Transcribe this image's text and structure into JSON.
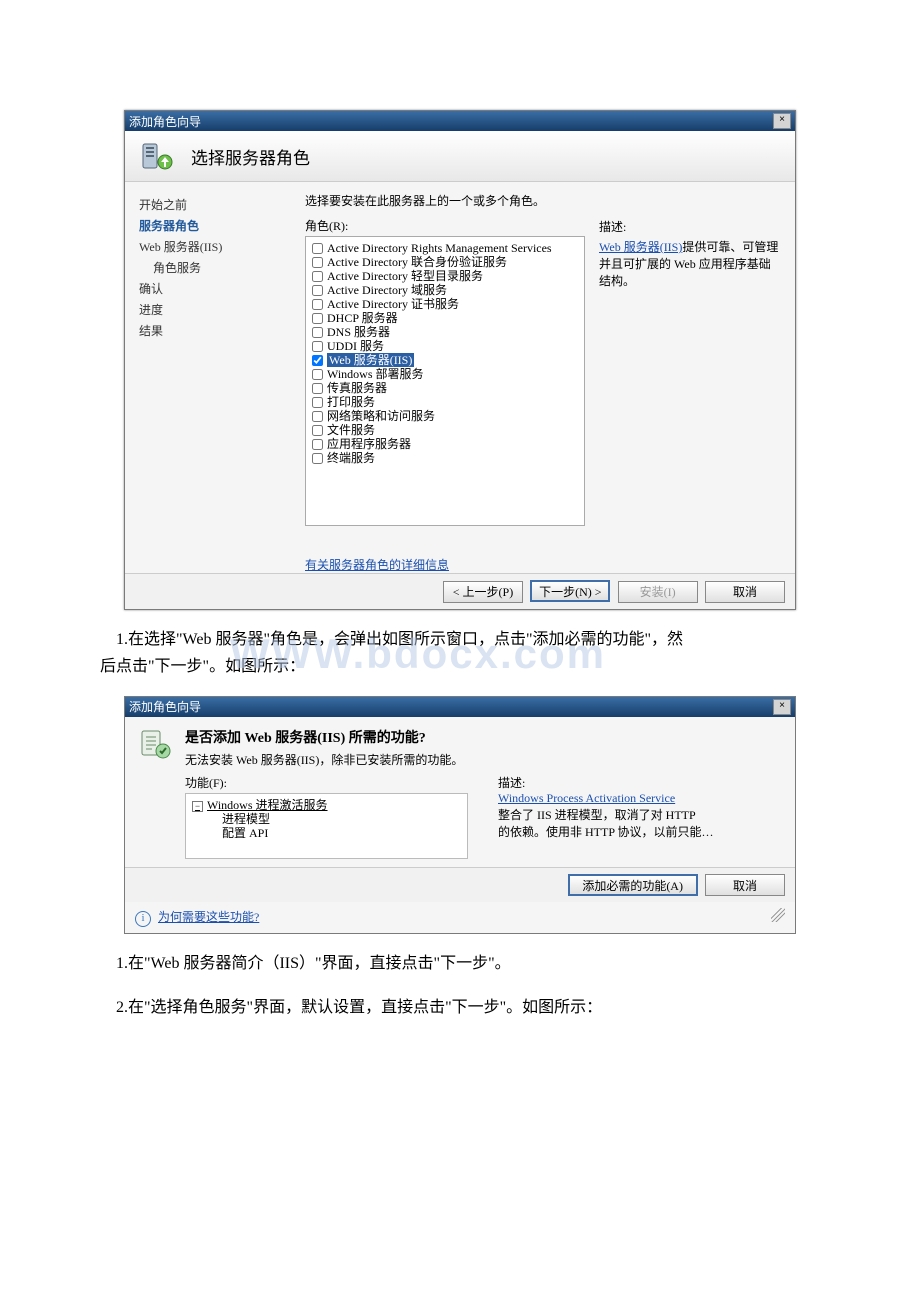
{
  "dlg1": {
    "title": "添加角色向导",
    "header": "选择服务器角色",
    "sidebar": [
      {
        "label": "开始之前",
        "active": false,
        "sub": false
      },
      {
        "label": "服务器角色",
        "active": true,
        "sub": false
      },
      {
        "label": "Web 服务器(IIS)",
        "active": false,
        "sub": false
      },
      {
        "label": "角色服务",
        "active": false,
        "sub": true
      },
      {
        "label": "确认",
        "active": false,
        "sub": false
      },
      {
        "label": "进度",
        "active": false,
        "sub": false
      },
      {
        "label": "结果",
        "active": false,
        "sub": false
      }
    ],
    "instruction": "选择要安装在此服务器上的一个或多个角色。",
    "roles_label": "角色(R):",
    "roles": [
      {
        "label": "Active Directory Rights Management Services",
        "checked": false,
        "selected": false
      },
      {
        "label": "Active Directory 联合身份验证服务",
        "checked": false,
        "selected": false
      },
      {
        "label": "Active Directory 轻型目录服务",
        "checked": false,
        "selected": false
      },
      {
        "label": "Active Directory 域服务",
        "checked": false,
        "selected": false
      },
      {
        "label": "Active Directory 证书服务",
        "checked": false,
        "selected": false
      },
      {
        "label": "DHCP 服务器",
        "checked": false,
        "selected": false
      },
      {
        "label": "DNS 服务器",
        "checked": false,
        "selected": false
      },
      {
        "label": "UDDI 服务",
        "checked": false,
        "selected": false
      },
      {
        "label": "Web 服务器(IIS)",
        "checked": true,
        "selected": true
      },
      {
        "label": "Windows 部署服务",
        "checked": false,
        "selected": false
      },
      {
        "label": "传真服务器",
        "checked": false,
        "selected": false
      },
      {
        "label": "打印服务",
        "checked": false,
        "selected": false
      },
      {
        "label": "网络策略和访问服务",
        "checked": false,
        "selected": false
      },
      {
        "label": "文件服务",
        "checked": false,
        "selected": false
      },
      {
        "label": "应用程序服务器",
        "checked": false,
        "selected": false
      },
      {
        "label": "终端服务",
        "checked": false,
        "selected": false
      }
    ],
    "desc_label": "描述:",
    "desc_link": "Web 服务器(IIS)",
    "desc_rest": "提供可靠、可管理并且可扩展的 Web 应用程序基础结构。",
    "more_link": "有关服务器角色的详细信息",
    "buttons": {
      "prev": "< 上一步(P)",
      "next": "下一步(N) >",
      "install": "安装(I)",
      "cancel": "取消"
    }
  },
  "para1a": "1.在选择\"Web 服务器\"角色是，会弹出如图所示窗口，点击\"添加必需的功能\"，然",
  "para1b": "后点击\"下一步\"。如图所示：",
  "watermark": "WWW.bdocx.com",
  "dlg2": {
    "title": "添加角色向导",
    "heading": "是否添加 Web 服务器(IIS) 所需的功能?",
    "subtext": "无法安装 Web 服务器(IIS)，除非已安装所需的功能。",
    "features_label": "功能(F):",
    "tree": {
      "parent": "Windows 进程激活服务",
      "children": [
        "进程模型",
        "配置 API"
      ]
    },
    "desc_label": "描述:",
    "desc_link": "Windows Process Activation Service",
    "desc_rest1": "整合了 IIS 进程模型，取消了对 HTTP",
    "desc_rest2": "的依赖。使用非 HTTP 协议，以前只能…",
    "buttons": {
      "add": "添加必需的功能(A)",
      "cancel": "取消"
    },
    "footer_link": "为何需要这些功能?"
  },
  "para2": "1.在\"Web 服务器简介（IIS）\"界面，直接点击\"下一步\"。",
  "para3": "2.在\"选择角色服务\"界面，默认设置，直接点击\"下一步\"。如图所示："
}
